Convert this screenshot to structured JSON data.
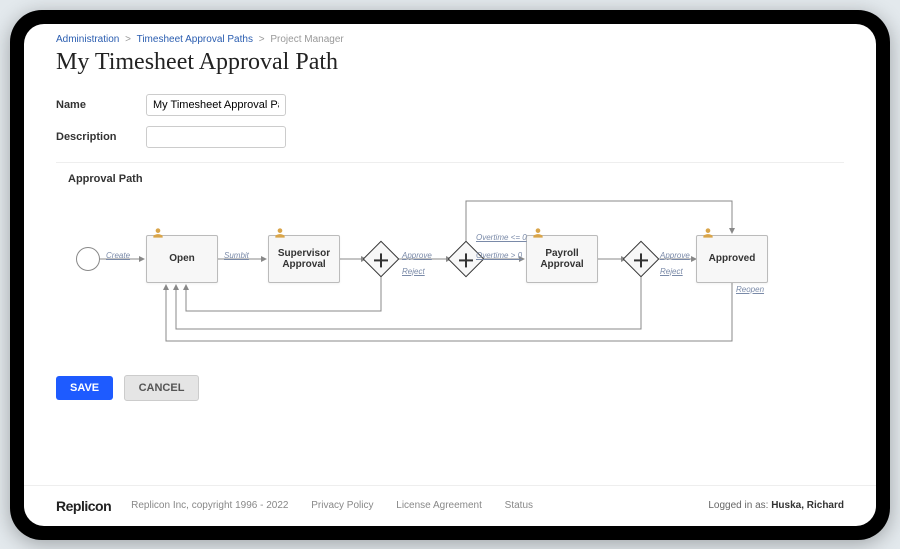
{
  "breadcrumb": {
    "a": "Administration",
    "b": "Timesheet Approval Paths",
    "c": "Project Manager"
  },
  "page": {
    "title": "My Timesheet Approval Path"
  },
  "form": {
    "name_label": "Name",
    "name_value": "My Timesheet Approval Path",
    "desc_label": "Description",
    "desc_value": ""
  },
  "section": {
    "approval_path": "Approval Path"
  },
  "nodes": {
    "open": "Open",
    "supervisor": "Supervisor Approval",
    "payroll": "Payroll Approval",
    "approved": "Approved"
  },
  "edges": {
    "create": "Create",
    "submit": "Sumbit",
    "approve1": "Approve",
    "reject1": "Reject",
    "ot_le0": "Overtime <= 0",
    "ot_gt0": "Overtime > 0",
    "approve2": "Approve",
    "reject2": "Reject",
    "reopen": "Reopen"
  },
  "buttons": {
    "save": "SAVE",
    "cancel": "CANCEL"
  },
  "footer": {
    "brand": "Replicon",
    "copyright": "Replicon Inc, copyright 1996 - 2022",
    "privacy": "Privacy Policy",
    "license": "License Agreement",
    "status": "Status",
    "logged_prefix": "Logged in as: ",
    "user": "Huska, Richard"
  }
}
